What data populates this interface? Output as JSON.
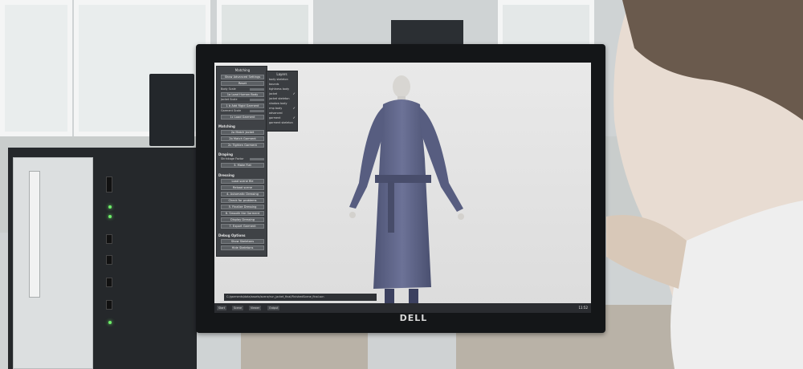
{
  "scene": {
    "brand": "DELL"
  },
  "app": {
    "panel_title": "Matching",
    "buttons": {
      "advanced": "Show Advanced Settings",
      "reset": "Reset",
      "load_body": "1a Load Human Body",
      "add_rigid": "1 b Add Rigid Garment",
      "load_garment": "1c Load Garment",
      "match_jacket": "2a Match Jacket",
      "match_garment": "2b Match Garment",
      "tighten": "2c Tighten Garment",
      "make_flat": "3. Make Flat",
      "load_scene": "Load scene file",
      "reload": "Reload scene",
      "auto_dressing": "4. Automatic Dressing",
      "check_problems": "Check for problems",
      "finalize": "5. Finalize Dressing",
      "smooth": "6. Smooth the Garment",
      "display": "Display Dressing",
      "export": "7. Export Garment",
      "show_skeletons": "Show Skeletons",
      "hide_skeletons": "Hide Skeletons"
    },
    "sections": {
      "matching": "Matching",
      "draping": "Draping",
      "dressing": "Dressing",
      "debug": "Debug Options"
    },
    "sliders": {
      "body_scale": "Body Scale",
      "jacket_scale": "Jacket Scale",
      "garment_scale": "Garment Scale",
      "shrinkage": "Shrinkage Factor"
    },
    "layers": {
      "title": "Layers",
      "items": [
        {
          "label": "body skeleton",
          "checked": false
        },
        {
          "label": "bounds",
          "checked": false
        },
        {
          "label": "tightness body",
          "checked": false
        },
        {
          "label": "jacket",
          "checked": true
        },
        {
          "label": "jacket skeleton",
          "checked": false
        },
        {
          "label": "shadow body",
          "checked": false
        },
        {
          "label": "rmp body",
          "checked": true
        },
        {
          "label": "advanced",
          "checked": false
        },
        {
          "label": "garment",
          "checked": true
        },
        {
          "label": "garment skeleton",
          "checked": false
        }
      ]
    },
    "status_path": "C:/garments/data/assets/scene/run_jacket_final/FinishedScene_final.scn",
    "taskbar": [
      "Start",
      "Scene",
      "Viewer",
      "Output"
    ],
    "tray_time": "11:52"
  }
}
